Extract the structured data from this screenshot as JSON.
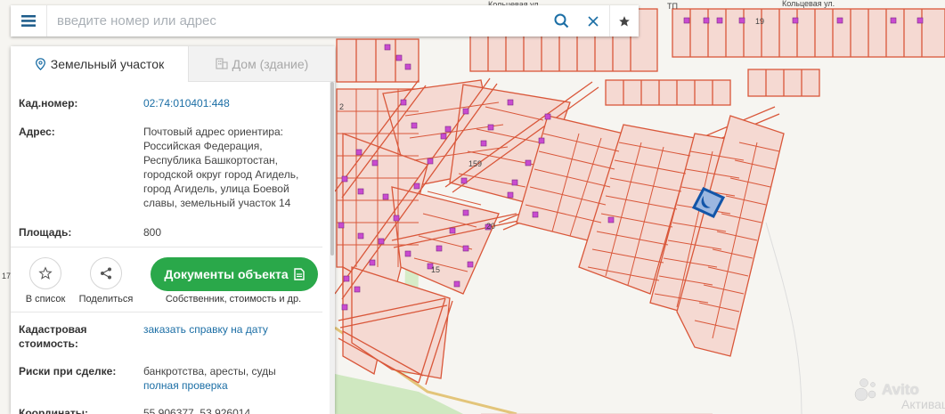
{
  "map": {
    "street_label_1": "Кольцевая ул.",
    "street_label_2": "Кольцевая ул.",
    "tp_label": "ТП",
    "plot_19": "19",
    "plot_159": "159",
    "plot_20": "20",
    "plot_15": "15",
    "plot_2": "2",
    "plot_17": "17"
  },
  "search": {
    "placeholder": "введите номер или адрес"
  },
  "tabs": [
    {
      "label": "Земельный участок",
      "active": true
    },
    {
      "label": "Дом (здание)",
      "active": false
    }
  ],
  "info": {
    "cadnum_label": "Кад.номер:",
    "cadnum_value": "02:74:010401:448",
    "address_label": "Адрес:",
    "address_lines": [
      "Почтовый адрес ориентира:",
      "Российская Федерация,",
      "Республика Башкортостан,",
      "городской округ город Агидель,",
      "город Агидель, улица Боевой",
      "славы, земельный участок 14"
    ],
    "area_label": "Площадь:",
    "area_value": "800"
  },
  "actions": {
    "save_label": "В список",
    "share_label": "Поделиться",
    "docs_label": "Документы объекта",
    "docs_caption": "Собственник, стоимость и др."
  },
  "details": {
    "cost_label_1": "Кадастровая",
    "cost_label_2": "стоимость:",
    "cost_link": "заказать справку на дату",
    "risks_label": "Риски при сделке:",
    "risks_value": "банкротства, аресты, суды",
    "risks_link": "полная проверка",
    "coords_label": "Координаты:",
    "coords_value": "55.906377, 53.926014"
  },
  "watermark": {
    "text": "Avito",
    "overlay": "Активаци"
  },
  "colors": {
    "parcel_stroke": "#d9573a",
    "parcel_fill": "#f5d9d2",
    "building": "#c94bd0",
    "accent_link": "#1b6ea5",
    "docs_button": "#2aa84a",
    "selected": "#1255a8"
  }
}
